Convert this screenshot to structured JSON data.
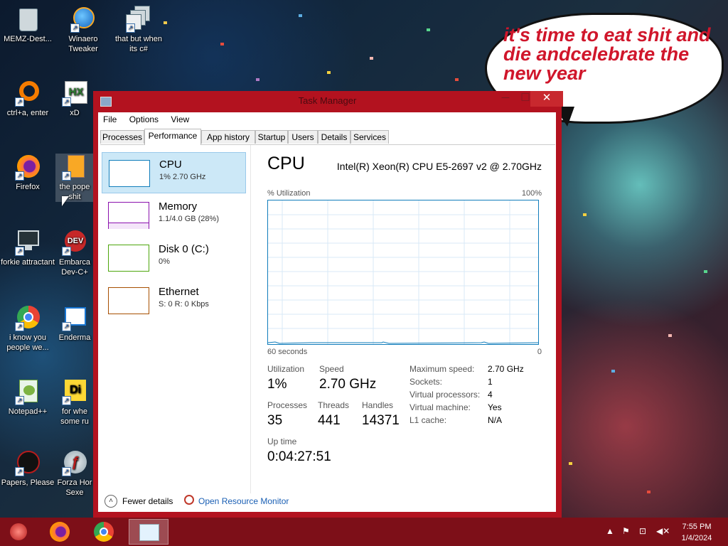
{
  "desktop": {
    "icons": [
      {
        "label": "MEMZ-Dest...",
        "icon": "recycle-bin-icon"
      },
      {
        "label": "Winaero Tweaker",
        "icon": "winaero-icon"
      },
      {
        "label": "that but when its c#",
        "icon": "windows-stack-icon"
      },
      {
        "label": "ctrl+a, enter",
        "icon": "orange-ring-icon"
      },
      {
        "label": "xD",
        "icon": "hxd-icon"
      },
      {
        "label": "Firefox",
        "icon": "firefox-icon"
      },
      {
        "label": "the pope shit",
        "icon": "file-icon"
      },
      {
        "label": "forkie attractant",
        "icon": "settings-monitor-icon"
      },
      {
        "label": "Embarca Dev-C+",
        "icon": "devcpp-icon"
      },
      {
        "label": "i know you people we...",
        "icon": "chrome-icon"
      },
      {
        "label": "Enderma",
        "icon": "window-icon"
      },
      {
        "label": "Notepad++",
        "icon": "notepadpp-icon"
      },
      {
        "label": "for whe some ru",
        "icon": "die-icon"
      },
      {
        "label": "Papers, Please",
        "icon": "papers-please-icon"
      },
      {
        "label": "Forza Hor Sexe",
        "icon": "flash-icon"
      }
    ],
    "bubble_text": "it's time to eat shit and die andcelebrate the new year"
  },
  "window": {
    "title": "Task Manager",
    "menu": [
      "File",
      "Options",
      "View"
    ],
    "tabs": [
      "Processes",
      "Performance",
      "App history",
      "Startup",
      "Users",
      "Details",
      "Services"
    ],
    "active_tab": "Performance"
  },
  "resources": [
    {
      "name": "CPU",
      "sub": "1% 2.70 GHz",
      "color": "#117dbb"
    },
    {
      "name": "Memory",
      "sub": "1.1/4.0 GB (28%)",
      "color": "#8b12ae"
    },
    {
      "name": "Disk 0 (C:)",
      "sub": "0%",
      "color": "#4da60c"
    },
    {
      "name": "Ethernet",
      "sub": "S: 0 R: 0 Kbps",
      "color": "#a74f01"
    }
  ],
  "cpu": {
    "heading": "CPU",
    "model": "Intel(R) Xeon(R) CPU E5-2697 v2 @ 2.70GHz",
    "graph_label": "% Utilization",
    "graph_max": "100%",
    "graph_time": "60 seconds",
    "graph_min": "0",
    "stats": {
      "utilization_label": "Utilization",
      "utilization": "1%",
      "speed_label": "Speed",
      "speed": "2.70 GHz",
      "processes_label": "Processes",
      "processes": "35",
      "threads_label": "Threads",
      "threads": "441",
      "handles_label": "Handles",
      "handles": "14371",
      "uptime_label": "Up time",
      "uptime": "0:04:27:51"
    },
    "details": [
      {
        "k": "Maximum speed:",
        "v": "2.70 GHz"
      },
      {
        "k": "Sockets:",
        "v": "1"
      },
      {
        "k": "Virtual processors:",
        "v": "4"
      },
      {
        "k": "Virtual machine:",
        "v": "Yes"
      },
      {
        "k": "L1 cache:",
        "v": "N/A"
      }
    ]
  },
  "footer": {
    "fewer_details": "Fewer details",
    "open_monitor": "Open Resource Monitor"
  },
  "taskbar": {
    "clock_time": "7:55 PM",
    "clock_date": "1/4/2024"
  }
}
